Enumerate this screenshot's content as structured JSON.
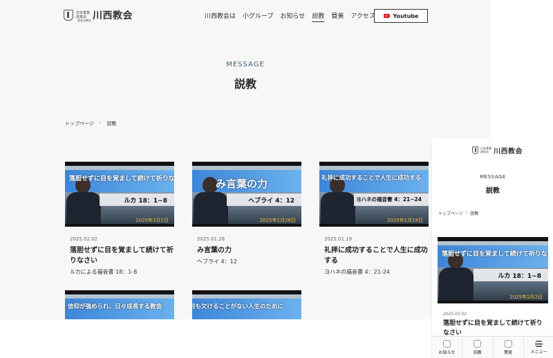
{
  "header": {
    "logo_main": "川西教会",
    "logo_small_1": "日本基督",
    "logo_small_2": "改革派",
    "logo_sub": "改革派教会",
    "nav": [
      "川西教会は",
      "小グループ",
      "お知らせ",
      "説教",
      "賛美",
      "アクセス"
    ],
    "nav_active": "説教",
    "youtube_label": "Youtube"
  },
  "section": {
    "en": "MESSAGE",
    "ja": "説教"
  },
  "breadcrumb": {
    "home": "トップページ",
    "sep": "-",
    "current": "説教"
  },
  "cards": [
    {
      "overlay": "落胆せずに目を覚まして続けて祈りなさい",
      "overlay_ref": "ルカ 18：1~8",
      "overlay_date": "2025年2月2日",
      "date": "2025.02.02",
      "title": "落胆せずに目を覚まして続けて祈りなさい",
      "ref": "ルカによる福音書 18：1-8"
    },
    {
      "overlay": "み言葉の力",
      "overlay_ref": "ヘブライ 4：12",
      "overlay_date": "2025年1月26日",
      "date": "2025.01.26",
      "title": "み言葉の力",
      "ref": "ヘブライ 4：12"
    },
    {
      "overlay": "礼拝に成功することで人生に成功する",
      "overlay_ref": "ヨハネの福音書 4：21~24",
      "overlay_date": "2025年1月19日",
      "date": "2025.01.19",
      "title": "礼拝に成功することで人生に成功する",
      "ref": "ヨハネの福音書 4：21-24"
    },
    {
      "overlay": "信仰が強められ、日々成長する教会"
    },
    {
      "overlay": "何も欠けることがない人生のために"
    }
  ],
  "mobile": {
    "en": "MESSAGE",
    "ja": "説教",
    "bc_home": "トップページ",
    "bc_sep": "›",
    "bc_current": "説教",
    "date": "2025.02.02",
    "title": "落胆せずに目を覚まして続けて祈りなさい",
    "tabs": [
      "お知らせ",
      "説教",
      "賛美",
      "メニュー"
    ]
  },
  "colors": {
    "accent_blue": "#3d86d8",
    "youtube_red": "#e51b1b",
    "heading_blue": "#4a5f75"
  }
}
